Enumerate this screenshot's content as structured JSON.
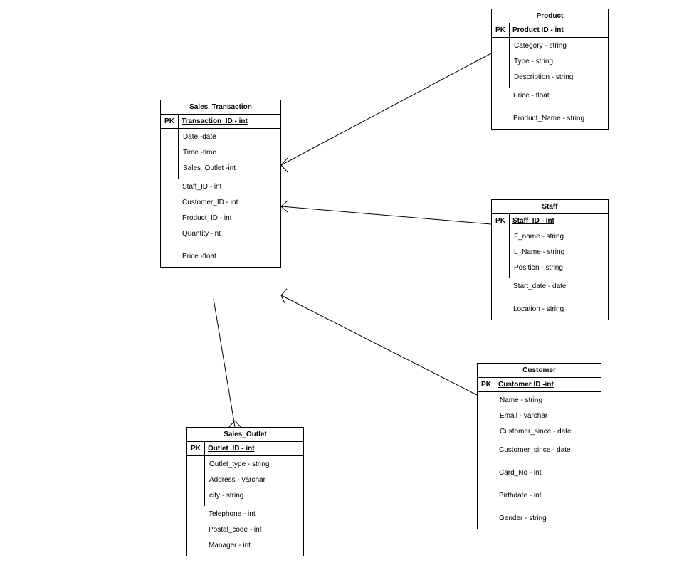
{
  "entities": {
    "sales_transaction": {
      "title": "Sales_Transaction",
      "pk_label": "PK",
      "pk_field": "Transaction_ID - int",
      "attrs_boxed": [
        "Date -date",
        "Time -time",
        "Sales_Outlet -int"
      ],
      "attrs_extra": [
        "Staff_ID - int",
        "Customer_ID - int",
        "Product_ID - int",
        "Quantity -int",
        "",
        "Price -float"
      ]
    },
    "product": {
      "title": "Product",
      "pk_label": "PK",
      "pk_field": "Product ID - int",
      "attrs_boxed": [
        "Category - string",
        "Type - string",
        "Description - string"
      ],
      "attrs_extra": [
        "Price - float",
        "",
        "Product_Name - string"
      ]
    },
    "staff": {
      "title": "Staff",
      "pk_label": "PK",
      "pk_field": "Staff_ID - int",
      "attrs_boxed": [
        "F_name - string",
        "L_Name - string",
        "Position - string"
      ],
      "attrs_extra": [
        "Start_date - date",
        "",
        "Location - string"
      ]
    },
    "customer": {
      "title": "Customer",
      "pk_label": "PK",
      "pk_field": "Customer ID -int",
      "attrs_boxed": [
        "Name - string",
        "Email - varchar",
        "Customer_since - date"
      ],
      "attrs_extra": [
        "Customer_since - date",
        "",
        "Card_No - int",
        "",
        "Birthdate - int",
        "",
        "Gender - string"
      ]
    },
    "sales_outlet": {
      "title": "Sales_Outlet",
      "pk_label": "PK",
      "pk_field": "Outlet_ID - int",
      "attrs_boxed": [
        "Outlet_type - string",
        "Address - varchar",
        "city - string"
      ],
      "attrs_extra": [
        "Telephone - int",
        "Postal_code - int",
        "Manager - int"
      ]
    }
  },
  "relationships": [
    {
      "from": "sales_transaction",
      "to": "product"
    },
    {
      "from": "sales_transaction",
      "to": "staff"
    },
    {
      "from": "sales_transaction",
      "to": "customer"
    },
    {
      "from": "sales_transaction",
      "to": "sales_outlet"
    }
  ]
}
